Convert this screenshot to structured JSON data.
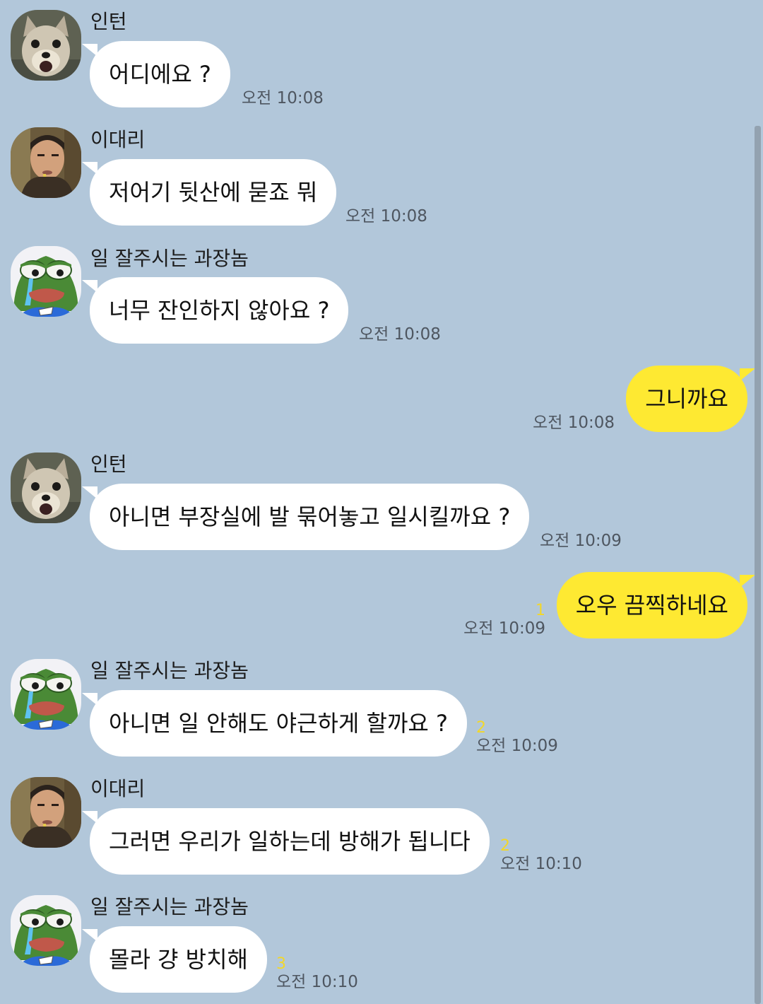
{
  "messages": [
    {
      "sender": "인턴",
      "text": "어디에요 ?",
      "time": "오전 10:08",
      "unread": ""
    },
    {
      "sender": "이대리",
      "text": "저어기 뒷산에 묻죠 뭐",
      "time": "오전 10:08",
      "unread": ""
    },
    {
      "sender": "일 잘주시는 과장놈",
      "text": "너무 잔인하지 않아요 ?",
      "time": "오전 10:08",
      "unread": ""
    },
    {
      "sender": "",
      "text": "그니까요",
      "time": "오전 10:08",
      "unread": ""
    },
    {
      "sender": "인턴",
      "text": "아니면 부장실에 발 묶어놓고 일시킬까요 ?",
      "time": "오전 10:09",
      "unread": ""
    },
    {
      "sender": "",
      "text": "오우 끔찍하네요",
      "time": "오전 10:09",
      "unread": "1"
    },
    {
      "sender": "일 잘주시는 과장놈",
      "text": "아니면 일 안해도 야근하게 할까요 ?",
      "time": "오전 10:09",
      "unread": "2"
    },
    {
      "sender": "이대리",
      "text": "그러면 우리가 일하는데 방해가 됩니다",
      "time": "오전 10:10",
      "unread": "2"
    },
    {
      "sender": "일 잘주시는 과장놈",
      "text": "몰라 걍 방치해",
      "time": "오전 10:10",
      "unread": "3"
    }
  ],
  "icons": {
    "intern_avatar": "dog-photo-avatar",
    "daeri_avatar": "man-photo-avatar",
    "manager_avatar": "crying-frog-avatar"
  },
  "colors": {
    "background": "#b2c7da",
    "incoming_bubble": "#ffffff",
    "outgoing_bubble": "#fee932",
    "unread_count": "#f2d72a"
  }
}
